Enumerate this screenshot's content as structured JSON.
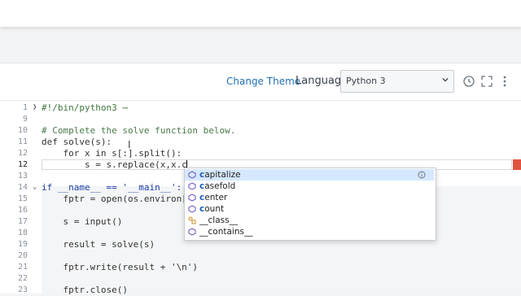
{
  "toolbar": {
    "change_theme": "Change Theme",
    "language_label": "Language",
    "language_value": "Python 3"
  },
  "code_lines": [
    {
      "num": "1",
      "fold": "right",
      "text": "#!/bin/python3 ⋯"
    },
    {
      "num": "9",
      "text": ""
    },
    {
      "num": "10",
      "text": "# Complete the solve function below."
    },
    {
      "num": "11",
      "text": "def solve(s):"
    },
    {
      "num": "12",
      "text": "    for x in s[:].split():"
    },
    {
      "num": "12",
      "active": true,
      "text": "        s = s.replace(x,x.c"
    },
    {
      "num": "13",
      "text": ""
    },
    {
      "num": "14",
      "fold": "down",
      "text": "if __name__ == '__main__':"
    },
    {
      "num": "15",
      "text": "    fptr = open(os.environ["
    },
    {
      "num": "16",
      "text": ""
    },
    {
      "num": "17",
      "text": "    s = input()"
    },
    {
      "num": "18",
      "text": ""
    },
    {
      "num": "19",
      "text": "    result = solve(s)"
    },
    {
      "num": "20",
      "text": ""
    },
    {
      "num": "21",
      "text": "    fptr.write(result + '\\n')"
    },
    {
      "num": "22",
      "text": ""
    },
    {
      "num": "23",
      "text": "    fptr.close()"
    }
  ],
  "autocomplete": {
    "items": [
      {
        "match": "c",
        "rest": "apitalize",
        "icon": "method-icon",
        "selected": true
      },
      {
        "match": "c",
        "rest": "asefold",
        "icon": "method-icon"
      },
      {
        "match": "c",
        "rest": "enter",
        "icon": "method-icon"
      },
      {
        "match": "c",
        "rest": "ount",
        "icon": "method-icon"
      },
      {
        "match": "",
        "rest": "__class__",
        "icon": "class-icon"
      },
      {
        "match": "",
        "rest": "__contains__",
        "icon": "method-icon"
      }
    ]
  },
  "colors": {
    "accent": "#1f6fb3",
    "error_marker": "#e0533e",
    "selection": "#d6e8ff"
  }
}
